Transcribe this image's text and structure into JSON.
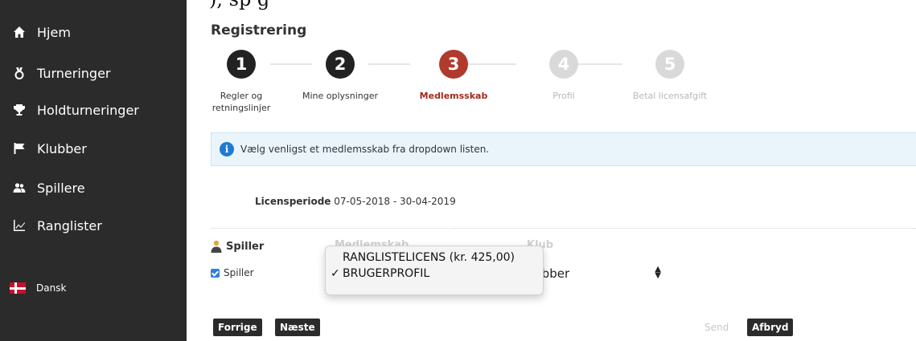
{
  "top_caption": "), sp g",
  "sidebar": {
    "items": [
      {
        "label": "Hjem",
        "icon": "home-icon"
      },
      {
        "label": "Turneringer",
        "icon": "medal-icon"
      },
      {
        "label": "Holdturneringer",
        "icon": "trophy-icon"
      },
      {
        "label": "Klubber",
        "icon": "flag-icon"
      },
      {
        "label": "Spillere",
        "icon": "users-icon"
      },
      {
        "label": "Ranglister",
        "icon": "line-chart-icon"
      }
    ],
    "language": {
      "label": "Dansk",
      "icon": "danish-flag-icon"
    }
  },
  "main": {
    "title": "Registrering",
    "steps": [
      {
        "number": "1",
        "label": "Regler og retningslinjer",
        "state": "done"
      },
      {
        "number": "2",
        "label": "Mine oplysninger",
        "state": "done"
      },
      {
        "number": "3",
        "label": "Medlemsskab",
        "state": "active"
      },
      {
        "number": "4",
        "label": "Profil",
        "state": "todo"
      },
      {
        "number": "5",
        "label": "Betal licensafgift",
        "state": "todo"
      }
    ],
    "info_message": "Vælg venligst et medlemsskab fra dropdown listen.",
    "license_period": {
      "label": "Licensperiode",
      "value": "07-05-2018 - 30-04-2019"
    },
    "player_section": {
      "heading": "Spiller",
      "checkbox_label": "Spiller",
      "checked": true
    },
    "faded_headings": [
      "Medlemskab",
      "Klub"
    ],
    "membership_dropdown": {
      "options": [
        {
          "label": "RANGLISTELICENS (kr. 425,00)",
          "selected": false
        },
        {
          "label": "BRUGERPROFIL",
          "selected": true
        }
      ]
    },
    "club_select": {
      "value": "lubber"
    },
    "buttons": {
      "previous": "Forrige",
      "next": "Næste",
      "send": "Send",
      "cancel": "Afbryd"
    }
  },
  "colors": {
    "sidebar_bg": "#2b2b2b",
    "active_step": "#b03a2e",
    "info_bg": "#eaf5fb",
    "checkbox": "#2f7fe0"
  }
}
